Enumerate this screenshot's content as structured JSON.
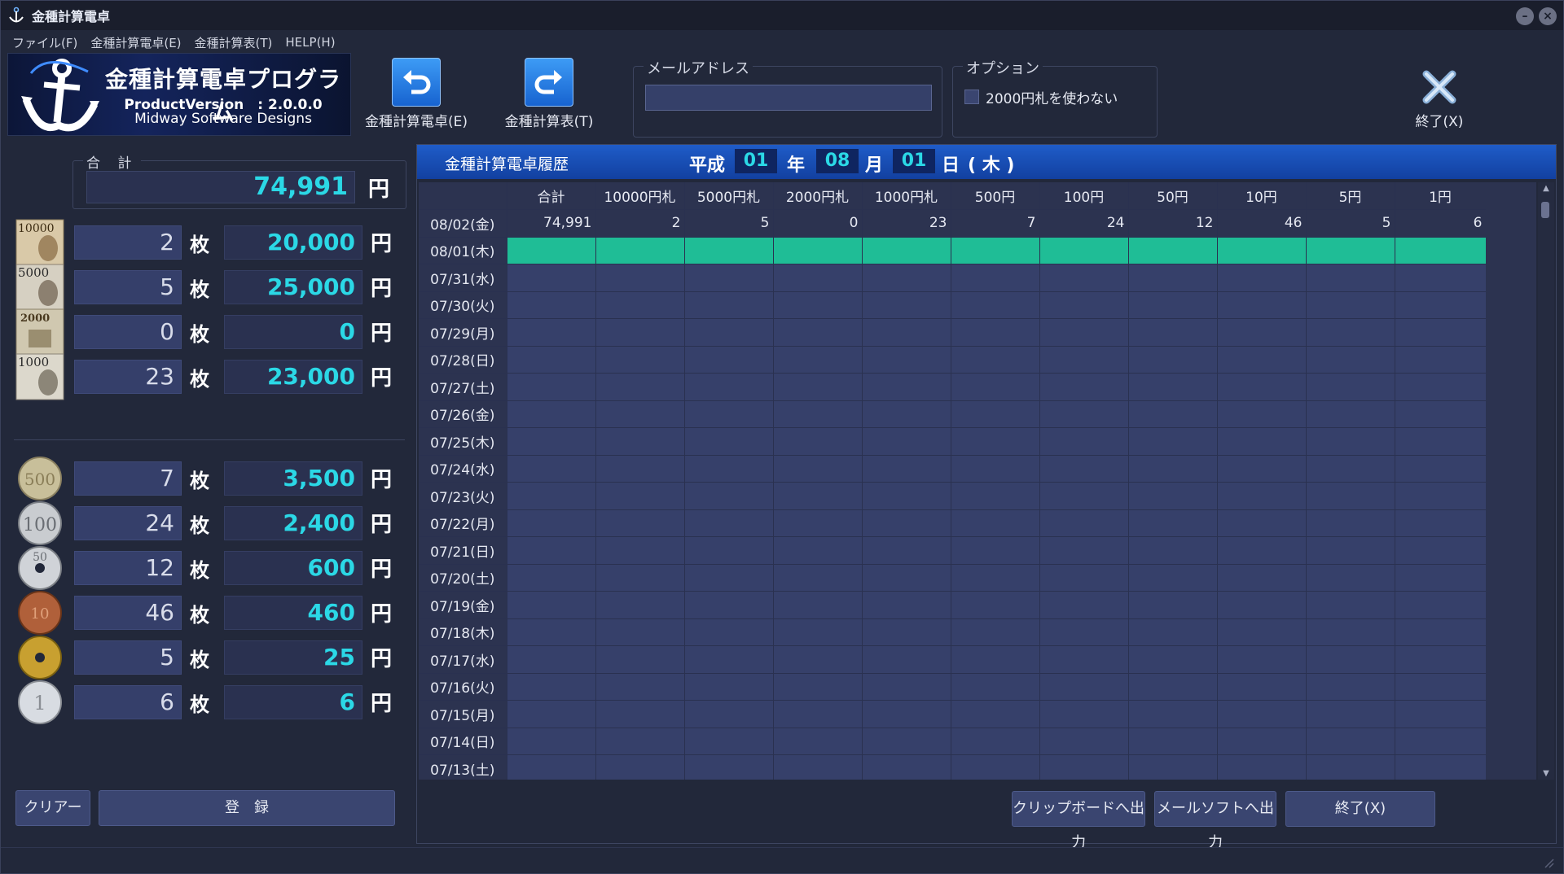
{
  "window": {
    "title": "金種計算電卓"
  },
  "menu": [
    "ファイル(F)",
    "金種計算電卓(E)",
    "金種計算表(T)",
    "HELP(H)"
  ],
  "logo": {
    "title": "金種計算電卓プログラム",
    "version": "ProductVersion　: 2.0.0.0",
    "company": "Midway Software Designs"
  },
  "toolbar": {
    "calc_label": "金種計算電卓(E)",
    "table_label": "金種計算表(T)",
    "exit_label": "終了(X)"
  },
  "mail": {
    "group_label": "メールアドレス",
    "value": ""
  },
  "option": {
    "group_label": "オプション",
    "checkbox_label": "2000円札を使わない",
    "checked": false
  },
  "summary": {
    "label": "合 計",
    "total": "74,991",
    "unit": "円"
  },
  "denominations": [
    {
      "icon": "10000-yen-bill-icon",
      "count": "2",
      "amount": "20,000"
    },
    {
      "icon": "5000-yen-bill-icon",
      "count": "5",
      "amount": "25,000"
    },
    {
      "icon": "2000-yen-bill-icon",
      "count": "0",
      "amount": "0"
    },
    {
      "icon": "1000-yen-bill-icon",
      "count": "23",
      "amount": "23,000"
    },
    {
      "icon": "500-yen-coin-icon",
      "count": "7",
      "amount": "3,500"
    },
    {
      "icon": "100-yen-coin-icon",
      "count": "24",
      "amount": "2,400"
    },
    {
      "icon": "50-yen-coin-icon",
      "count": "12",
      "amount": "600"
    },
    {
      "icon": "10-yen-coin-icon",
      "count": "46",
      "amount": "460"
    },
    {
      "icon": "5-yen-coin-icon",
      "count": "5",
      "amount": "25"
    },
    {
      "icon": "1-yen-coin-icon",
      "count": "6",
      "amount": "6"
    }
  ],
  "units": {
    "mai": "枚",
    "yen": "円"
  },
  "bill_texts": {
    "b10000": "10000",
    "b5000": "5000",
    "b2000": "2000",
    "b1000": "1000"
  },
  "coin_texts": {
    "c500": "500",
    "c100": "100",
    "c50": "50",
    "c10": "10",
    "c5": "",
    "c1": "1"
  },
  "buttons": {
    "clear": "クリアー",
    "register": "登　録",
    "clipboard": "クリップボードへ出力",
    "mailsoft": "メールソフトへ出力",
    "exit": "終了(X)"
  },
  "history": {
    "title": "金種計算電卓履歴",
    "era": "平成",
    "year": "01",
    "year_unit": "年",
    "month": "08",
    "month_unit": "月",
    "day": "01",
    "day_unit": "日",
    "weekday": "( 木 )",
    "columns": [
      "",
      "合計",
      "10000円札",
      "5000円札",
      "2000円札",
      "1000円札",
      "500円",
      "100円",
      "50円",
      "10円",
      "5円",
      "1円"
    ],
    "rows": [
      {
        "date": "08/02(金)",
        "values": [
          "74,991",
          "2",
          "5",
          "0",
          "23",
          "7",
          "24",
          "12",
          "46",
          "5",
          "6"
        ]
      },
      {
        "date": "08/01(木)",
        "values": [
          "",
          "",
          "",
          "",
          "",
          "",
          "",
          "",
          "",
          "",
          ""
        ]
      },
      {
        "date": "07/31(水)",
        "values": []
      },
      {
        "date": "07/30(火)",
        "values": []
      },
      {
        "date": "07/29(月)",
        "values": []
      },
      {
        "date": "07/28(日)",
        "values": []
      },
      {
        "date": "07/27(土)",
        "values": []
      },
      {
        "date": "07/26(金)",
        "values": []
      },
      {
        "date": "07/25(木)",
        "values": []
      },
      {
        "date": "07/24(水)",
        "values": []
      },
      {
        "date": "07/23(火)",
        "values": []
      },
      {
        "date": "07/22(月)",
        "values": []
      },
      {
        "date": "07/21(日)",
        "values": []
      },
      {
        "date": "07/20(土)",
        "values": []
      },
      {
        "date": "07/19(金)",
        "values": []
      },
      {
        "date": "07/18(木)",
        "values": []
      },
      {
        "date": "07/17(水)",
        "values": []
      },
      {
        "date": "07/16(火)",
        "values": []
      },
      {
        "date": "07/15(月)",
        "values": []
      },
      {
        "date": "07/14(日)",
        "values": []
      },
      {
        "date": "07/13(土)",
        "values": []
      }
    ],
    "selected_row_index": 1
  },
  "colors": {
    "accent_cyan": "#2bd8e6",
    "selection_green": "#1fbd96",
    "header_blue": "#1f5cc8"
  }
}
